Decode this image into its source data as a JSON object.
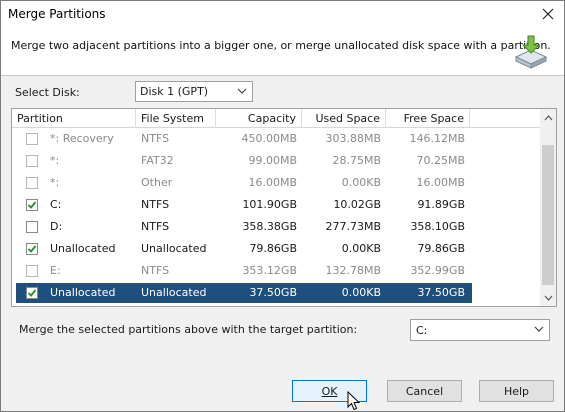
{
  "window": {
    "title": "Merge Partitions",
    "description": "Merge two adjacent partitions into a bigger one, or merge unallocated disk space with a partition."
  },
  "disk": {
    "label": "Select Disk:",
    "selected": "Disk 1 (GPT)"
  },
  "table": {
    "columns": [
      "Partition",
      "File System",
      "Capacity",
      "Used Space",
      "Free Space"
    ],
    "rows": [
      {
        "partition": "*: Recovery",
        "fs": "NTFS",
        "capacity": "450.00MB",
        "used": "303.88MB",
        "free": "146.12MB",
        "checked": false,
        "disabled": true,
        "selected": false
      },
      {
        "partition": "*:",
        "fs": "FAT32",
        "capacity": "99.00MB",
        "used": "28.75MB",
        "free": "70.25MB",
        "checked": false,
        "disabled": true,
        "selected": false
      },
      {
        "partition": "*:",
        "fs": "Other",
        "capacity": "16.00MB",
        "used": "0.00KB",
        "free": "16.00MB",
        "checked": false,
        "disabled": true,
        "selected": false
      },
      {
        "partition": "C:",
        "fs": "NTFS",
        "capacity": "101.90GB",
        "used": "10.02GB",
        "free": "91.89GB",
        "checked": true,
        "disabled": false,
        "selected": false
      },
      {
        "partition": "D:",
        "fs": "NTFS",
        "capacity": "358.38GB",
        "used": "277.73MB",
        "free": "358.10GB",
        "checked": false,
        "disabled": false,
        "selected": false
      },
      {
        "partition": "Unallocated",
        "fs": "Unallocated",
        "capacity": "79.86GB",
        "used": "0.00KB",
        "free": "79.86GB",
        "checked": true,
        "disabled": false,
        "selected": false
      },
      {
        "partition": "E:",
        "fs": "NTFS",
        "capacity": "353.12GB",
        "used": "132.78MB",
        "free": "352.99GB",
        "checked": false,
        "disabled": true,
        "selected": false
      },
      {
        "partition": "Unallocated",
        "fs": "Unallocated",
        "capacity": "37.50GB",
        "used": "0.00KB",
        "free": "37.50GB",
        "checked": true,
        "disabled": false,
        "selected": true
      }
    ]
  },
  "merge": {
    "label": "Merge the selected partitions above with the target partition:",
    "target": "C:"
  },
  "buttons": {
    "ok": "OK",
    "cancel": "Cancel",
    "help": "Help"
  },
  "colors": {
    "selection": "#1e4f7d",
    "check": "#1f8f2f",
    "accent": "#0078d7"
  },
  "icons": [
    "close-icon",
    "merge-disk-icon",
    "chevron-down-icon",
    "check-icon",
    "scroll-up-icon",
    "scroll-down-icon",
    "mouse-cursor-icon"
  ]
}
